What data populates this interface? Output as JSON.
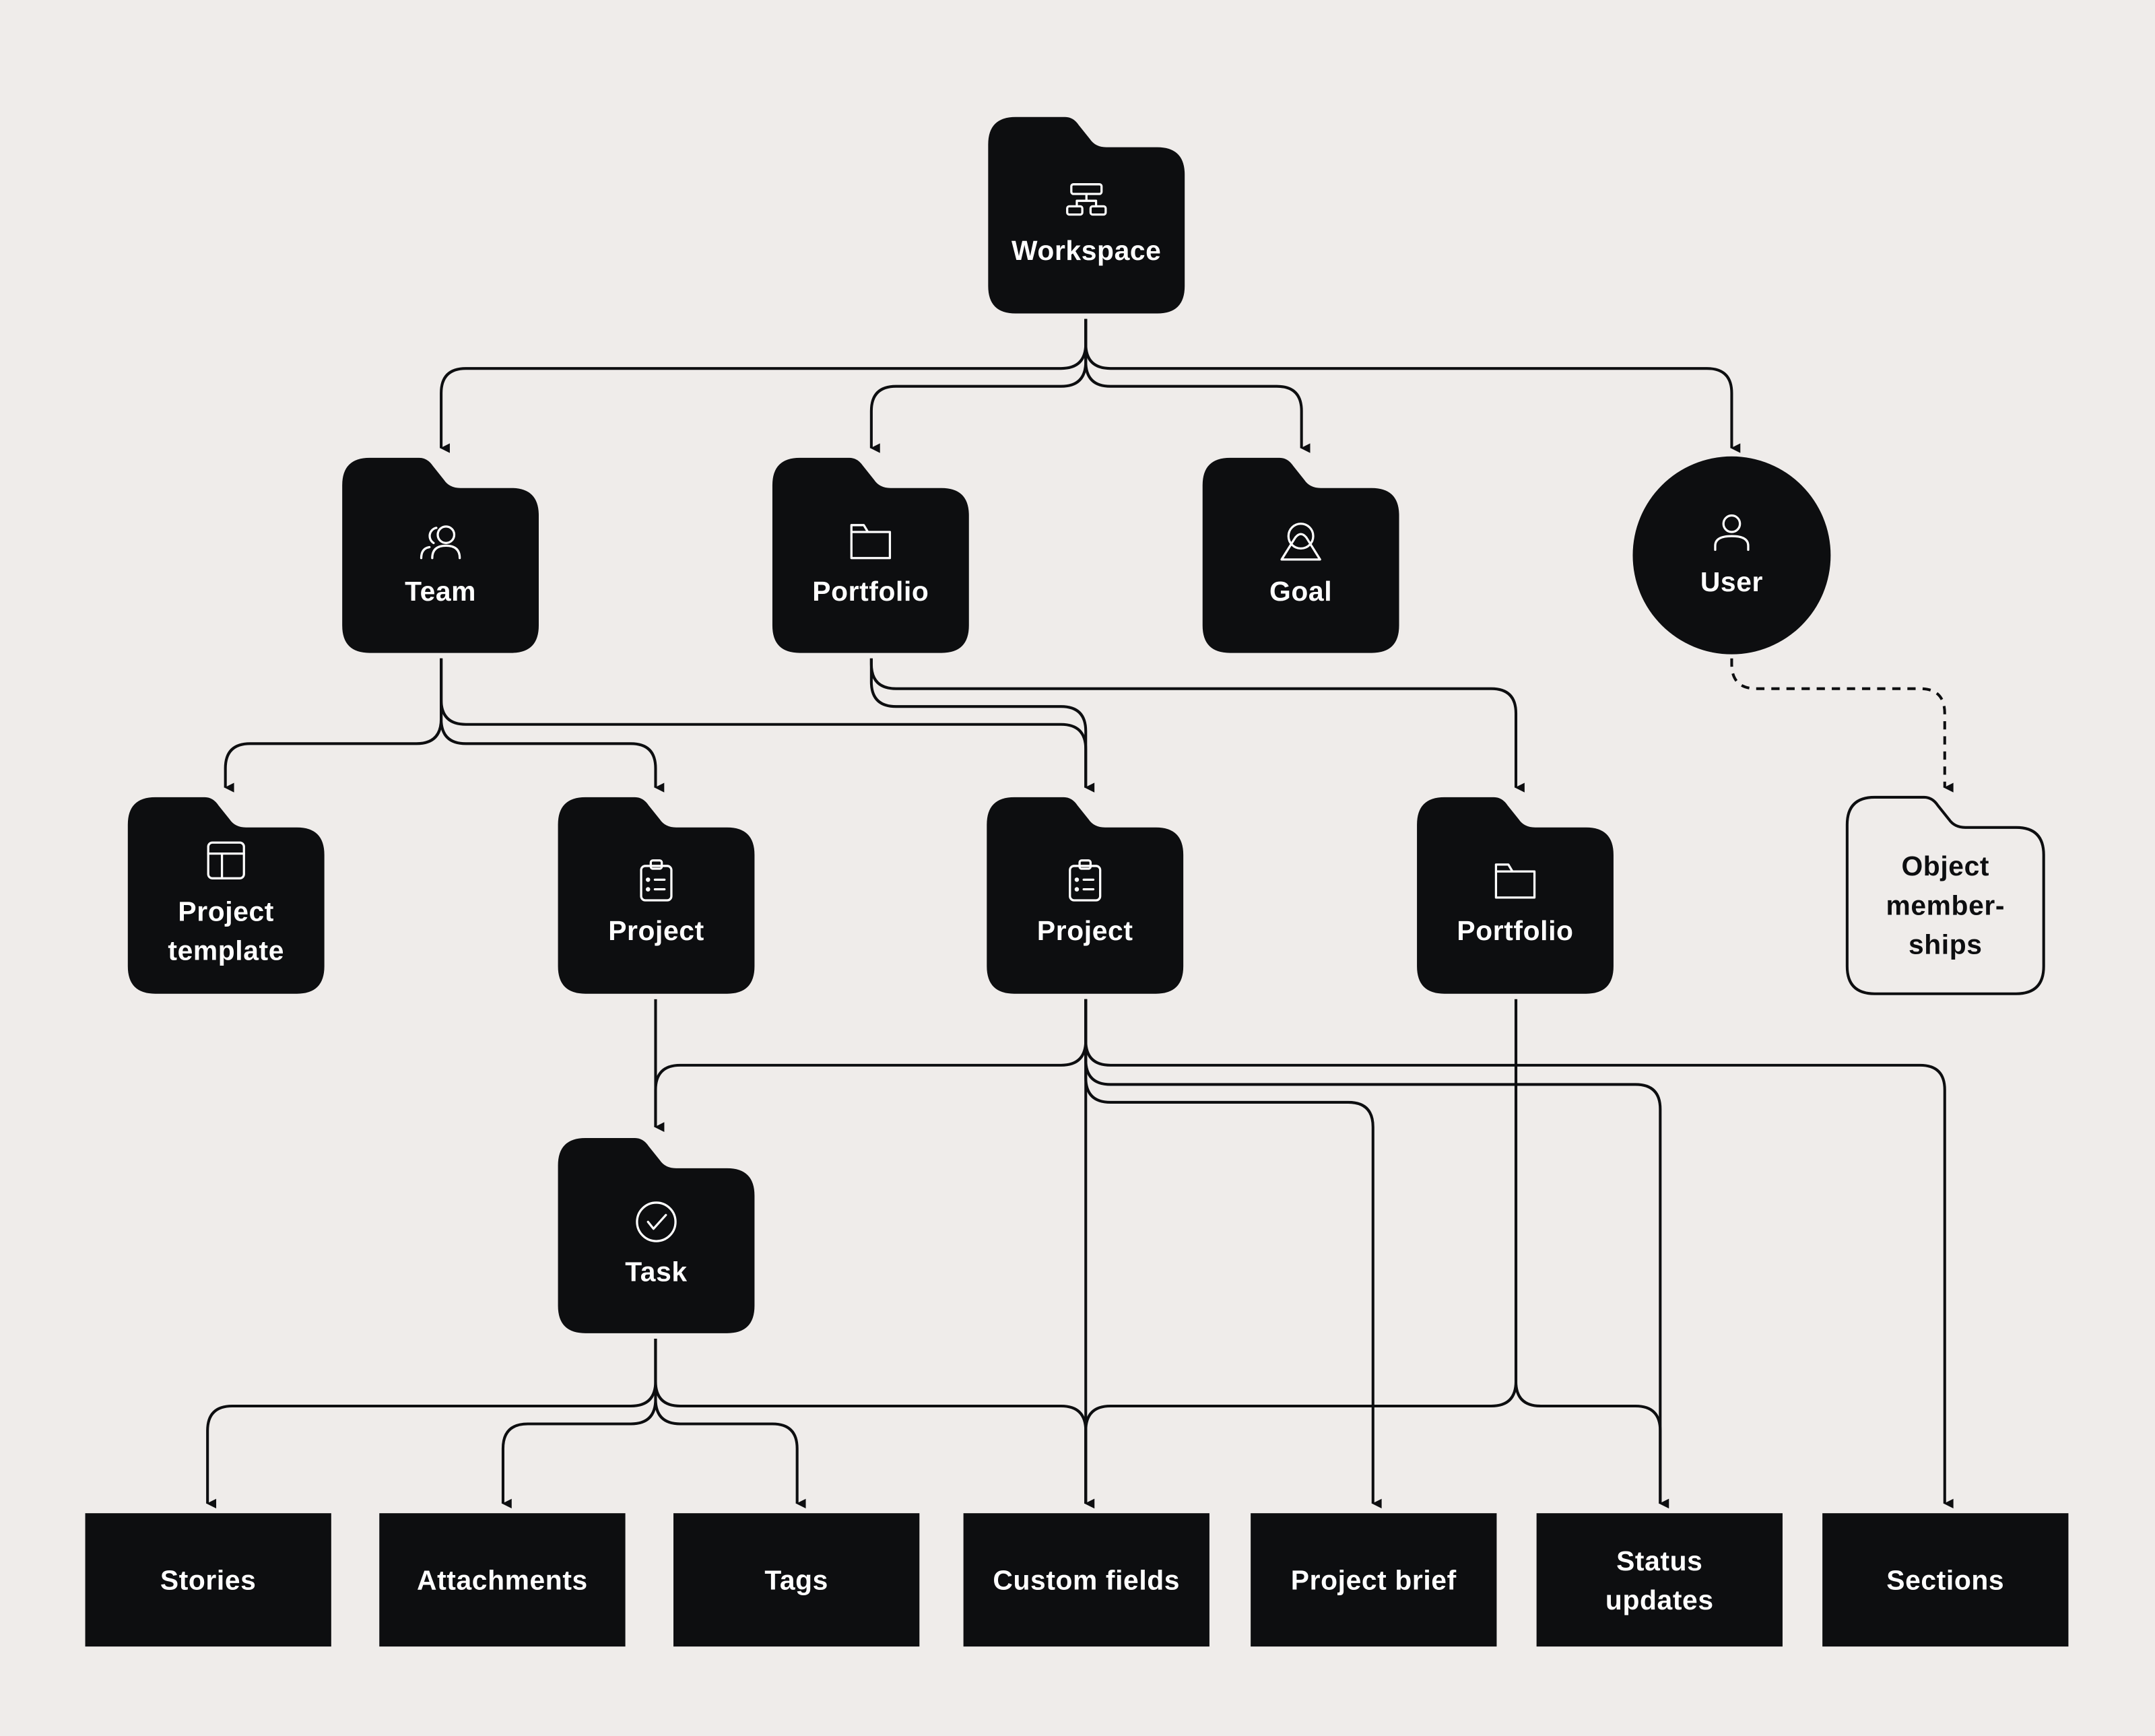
{
  "colors": {
    "background": "#efecea",
    "node_fill": "#0d0e10",
    "node_text": "#ffffff",
    "outline_node_fill": "#efecea"
  },
  "nodes": {
    "workspace": {
      "lines": [
        "Workspace"
      ],
      "icon": "hierarchy-icon",
      "shape": "folder"
    },
    "team": {
      "lines": [
        "Team"
      ],
      "icon": "users-icon",
      "shape": "folder"
    },
    "portfolio_top": {
      "lines": [
        "Portfolio"
      ],
      "icon": "folder-icon",
      "shape": "folder"
    },
    "goal": {
      "lines": [
        "Goal"
      ],
      "icon": "goal-icon",
      "shape": "folder"
    },
    "user": {
      "lines": [
        "User"
      ],
      "icon": "user-icon",
      "shape": "circle"
    },
    "project_template": {
      "lines": [
        "Project",
        "template"
      ],
      "icon": "template-icon",
      "shape": "folder"
    },
    "project_team": {
      "lines": [
        "Project"
      ],
      "icon": "clipboard-icon",
      "shape": "folder"
    },
    "project_main": {
      "lines": [
        "Project"
      ],
      "icon": "clipboard-icon",
      "shape": "folder"
    },
    "portfolio_nested": {
      "lines": [
        "Portfolio"
      ],
      "icon": "folder-icon",
      "shape": "folder"
    },
    "object_memberships": {
      "lines": [
        "Object",
        "member-",
        "ships"
      ],
      "icon": "",
      "shape": "folder-outline"
    },
    "task": {
      "lines": [
        "Task"
      ],
      "icon": "check-circle-icon",
      "shape": "folder"
    },
    "stories": {
      "lines": [
        "Stories"
      ],
      "shape": "box"
    },
    "attachments": {
      "lines": [
        "Attachments"
      ],
      "shape": "box"
    },
    "tags": {
      "lines": [
        "Tags"
      ],
      "shape": "box"
    },
    "custom_fields": {
      "lines": [
        "Custom fields"
      ],
      "shape": "box"
    },
    "project_brief": {
      "lines": [
        "Project brief"
      ],
      "shape": "box"
    },
    "status_updates": {
      "lines": [
        "Status",
        "updates"
      ],
      "shape": "box"
    },
    "sections": {
      "lines": [
        "Sections"
      ],
      "shape": "box"
    }
  },
  "edges": [
    {
      "from": "workspace",
      "to": "team"
    },
    {
      "from": "workspace",
      "to": "portfolio_top"
    },
    {
      "from": "workspace",
      "to": "goal"
    },
    {
      "from": "workspace",
      "to": "user"
    },
    {
      "from": "team",
      "to": "project_template"
    },
    {
      "from": "team",
      "to": "project_team"
    },
    {
      "from": "team",
      "to": "project_main"
    },
    {
      "from": "portfolio_top",
      "to": "project_main"
    },
    {
      "from": "portfolio_top",
      "to": "portfolio_nested"
    },
    {
      "from": "user",
      "to": "object_memberships",
      "style": "dashed"
    },
    {
      "from": "project_team",
      "to": "task"
    },
    {
      "from": "project_main",
      "to": "task"
    },
    {
      "from": "project_main",
      "to": "custom_fields"
    },
    {
      "from": "project_main",
      "to": "project_brief"
    },
    {
      "from": "project_main",
      "to": "status_updates"
    },
    {
      "from": "project_main",
      "to": "sections"
    },
    {
      "from": "portfolio_nested",
      "to": "custom_fields"
    },
    {
      "from": "portfolio_nested",
      "to": "status_updates"
    },
    {
      "from": "task",
      "to": "stories"
    },
    {
      "from": "task",
      "to": "attachments"
    },
    {
      "from": "task",
      "to": "tags"
    },
    {
      "from": "task",
      "to": "custom_fields"
    }
  ]
}
